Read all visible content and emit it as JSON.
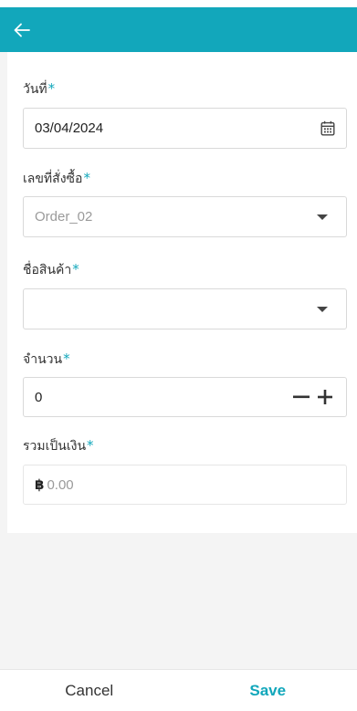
{
  "header": {
    "back_icon": "arrow-left-icon"
  },
  "colors": {
    "accent": "#12a7bb",
    "required_marker": "#12a7bb"
  },
  "form": {
    "date": {
      "label": "วันที่",
      "required": "*",
      "value": "03/04/2024",
      "icon": "calendar-icon"
    },
    "order_no": {
      "label": "เลขที่สั่งซื้อ",
      "required": "*",
      "value": "Order_02",
      "icon": "chevron-down-icon"
    },
    "product_name": {
      "label": "ชื่อสินค้า",
      "required": "*",
      "value": "",
      "icon": "chevron-down-icon"
    },
    "quantity": {
      "label": "จำนวน",
      "required": "*",
      "value": "0",
      "minus_icon": "minus-icon",
      "plus_icon": "plus-icon"
    },
    "total": {
      "label": "รวมเป็นเงิน",
      "required": "*",
      "currency": "฿",
      "value": "0.00"
    }
  },
  "footer": {
    "cancel_label": "Cancel",
    "save_label": "Save"
  }
}
